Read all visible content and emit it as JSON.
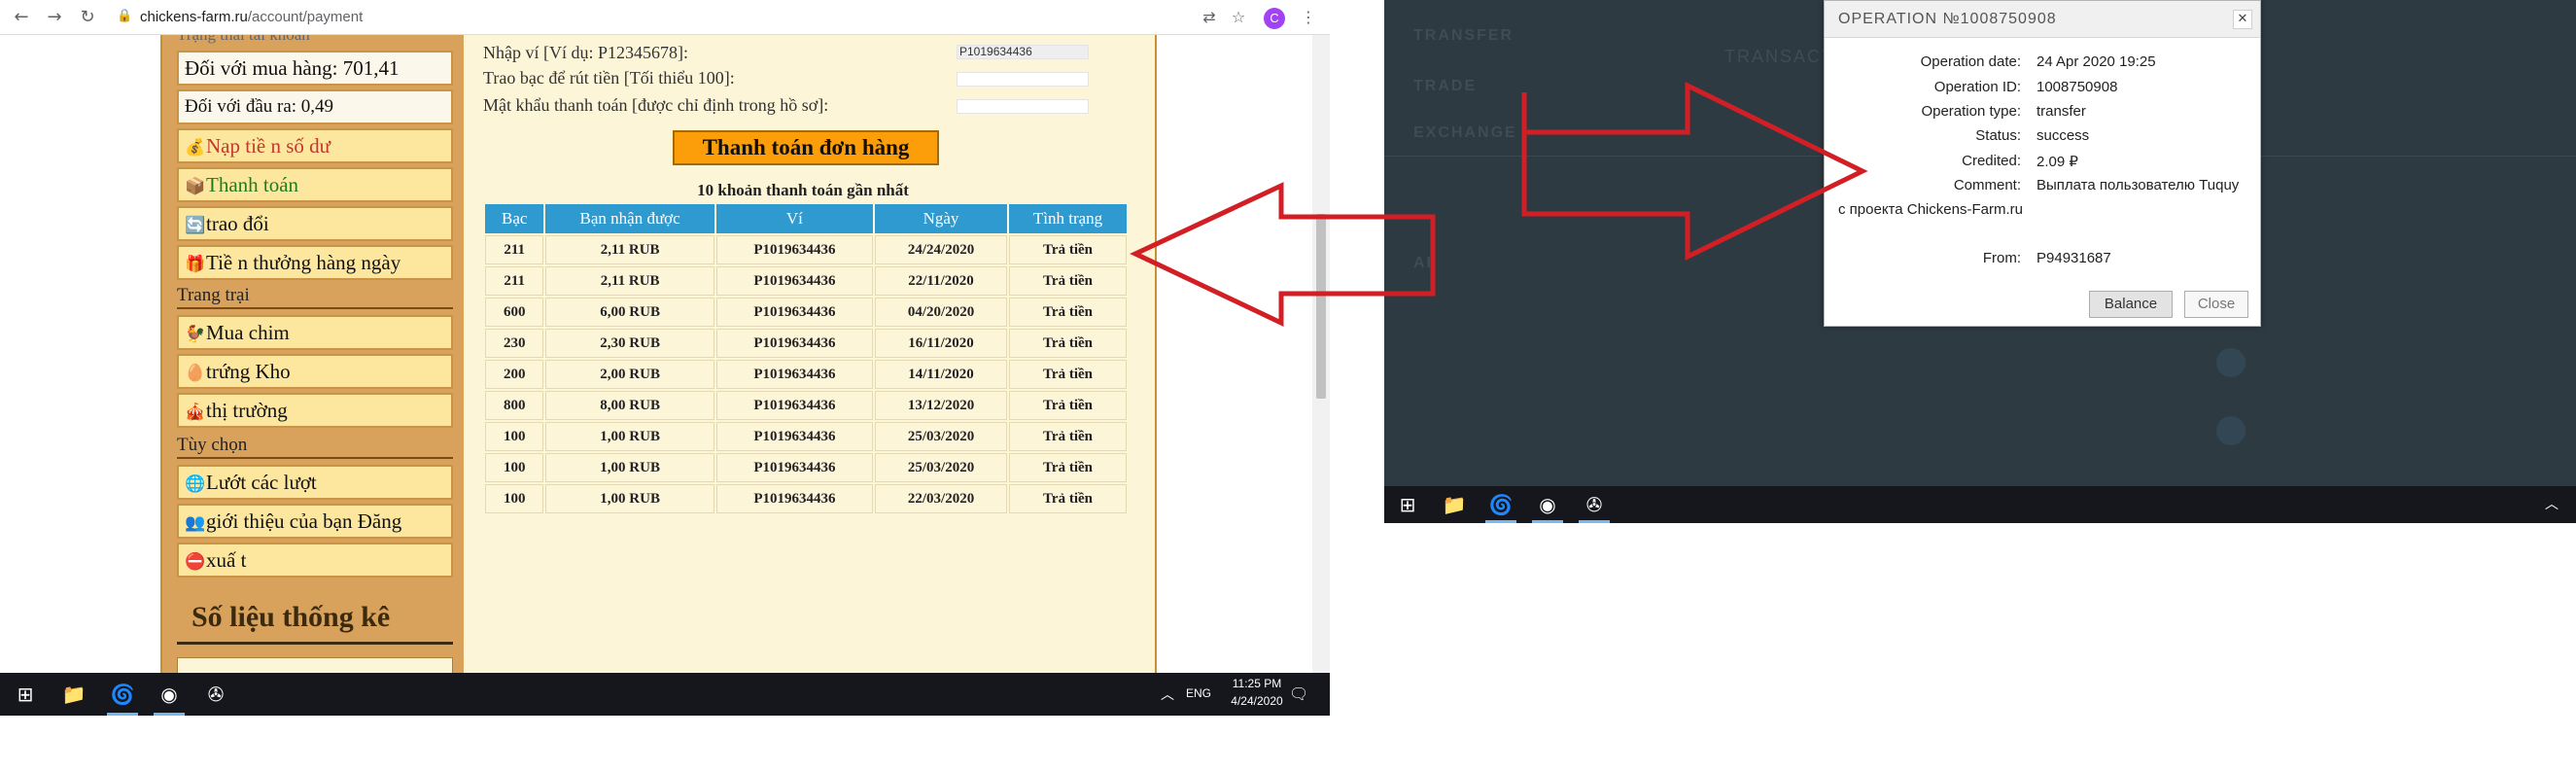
{
  "browser": {
    "url_domain": "chickens-farm.ru",
    "url_path": "/account/payment",
    "avatar_letter": "C"
  },
  "sidebar": {
    "section_top": "Trạng thái tài khoản",
    "balance_buy": "Đối với mua hàng: 701,41",
    "balance_out": "Đối với đầu ra: 0,49",
    "items_account": [
      {
        "icon": "💰",
        "label": "Nạp tiề n số dư",
        "color": "#c0392b"
      },
      {
        "icon": "📦",
        "label": "Thanh toán",
        "color": "#1e7d1e"
      },
      {
        "icon": "🔄",
        "label": "trao đổi",
        "color": "#111111"
      },
      {
        "icon": "🎁",
        "label": "Tiề n thưởng hàng ngày",
        "color": "#111111"
      }
    ],
    "section_farm": "Trang trại",
    "items_farm": [
      {
        "icon": "🐓",
        "label": "Mua chim"
      },
      {
        "icon": "🥚",
        "label": "trứng Kho"
      },
      {
        "icon": "🎪",
        "label": "thị trường"
      }
    ],
    "section_options": "Tùy chọn",
    "items_options": [
      {
        "icon": "🌐",
        "label": "Lướt các lượt"
      },
      {
        "icon": "👥",
        "label": "giới thiệu của bạn Đăng"
      },
      {
        "icon": "⛔",
        "label": "xuấ t"
      }
    ],
    "stats_title": "Số liệu thống kê"
  },
  "form": {
    "wallet_label": "Nhập ví [Ví dụ: P12345678]:",
    "wallet_value": "P1019634436",
    "amount_label": "Trao bạc để rút tiền [Tối thiểu 100]:",
    "password_label": "Mật khẩu thanh toán [được chỉ định trong hồ sơ]:",
    "pay_button": "Thanh toán đơn hàng"
  },
  "payments": {
    "title": "10 khoản thanh toán gần nhất",
    "headers": [
      "Bạc",
      "Bạn nhận được",
      "Ví",
      "Ngày",
      "Tình trạng"
    ],
    "rows": [
      [
        "211",
        "2,11 RUB",
        "P1019634436",
        "24/24/2020",
        "Trả tiền"
      ],
      [
        "211",
        "2,11 RUB",
        "P1019634436",
        "22/11/2020",
        "Trả tiền"
      ],
      [
        "600",
        "6,00 RUB",
        "P1019634436",
        "04/20/2020",
        "Trả tiền"
      ],
      [
        "230",
        "2,30 RUB",
        "P1019634436",
        "16/11/2020",
        "Trả tiền"
      ],
      [
        "200",
        "2,00 RUB",
        "P1019634436",
        "14/11/2020",
        "Trả tiền"
      ],
      [
        "800",
        "8,00 RUB",
        "P1019634436",
        "13/12/2020",
        "Trả tiền"
      ],
      [
        "100",
        "1,00 RUB",
        "P1019634436",
        "25/03/2020",
        "Trả tiền"
      ],
      [
        "100",
        "1,00 RUB",
        "P1019634436",
        "25/03/2020",
        "Trả tiền"
      ],
      [
        "100",
        "1,00 RUB",
        "P1019634436",
        "22/03/2020",
        "Trả tiền"
      ]
    ]
  },
  "taskbar_left": {
    "lang": "ENG",
    "time": "11:25 PM",
    "date": "4/24/2020"
  },
  "dark_bg": {
    "menu": [
      "TRANSFER",
      "TRADE",
      "EXCHANGE",
      "AI"
    ],
    "header": "TRANSACTIONS"
  },
  "modal": {
    "title": "OPERATION №1008750908",
    "rows": [
      {
        "k": "Operation date:",
        "v": "24 Apr 2020 19:25"
      },
      {
        "k": "Operation ID:",
        "v": "1008750908"
      },
      {
        "k": "Operation type:",
        "v": "transfer"
      },
      {
        "k": "Status:",
        "v": "success"
      },
      {
        "k": "Credited:",
        "v": "2.09 ₽"
      },
      {
        "k": "Comment:",
        "v": "Выплата пользователю Tuquy"
      }
    ],
    "comment_cont": "с проекта Chickens-Farm.ru",
    "from_label": "From:",
    "from_value": "P94931687",
    "balance_button": "Balance",
    "close_button": "Close",
    "close_x": "✕"
  },
  "colors": {
    "arrow_red": "#d21f26",
    "table_header": "#2f9ad0",
    "pay_button": "#fb9e09",
    "sidebar_bg": "#d9a25c"
  }
}
